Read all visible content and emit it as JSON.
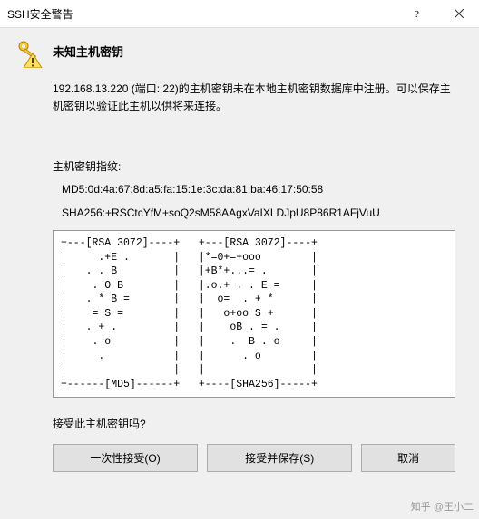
{
  "window": {
    "title": "SSH安全警告"
  },
  "header": {
    "title": "未知主机密钥"
  },
  "message": "192.168.13.220 (端口: 22)的主机密钥未在本地主机密钥数据库中注册。可以保存主机密钥以验证此主机以供将来连接。",
  "fingerprint": {
    "label": "主机密钥指纹:",
    "md5": "MD5:0d:4a:67:8d:a5:fa:15:1e:3c:da:81:ba:46:17:50:58",
    "sha256": "SHA256:+RSCtcYfM+soQ2sM58AAgxVaIXLDJpU8P86R1AFjVuU",
    "ascii": "+---[RSA 3072]----+   +---[RSA 3072]----+\n|     .+E .       |   |*=0+=+ooo        |\n|   . . B         |   |+B*+...= .       |\n|    . O B        |   |.o.+ . . E =     |\n|   . * B =       |   |  o=  . + *      |\n|    = S =        |   |   o+oo S +      |\n|   . + .         |   |    oB . = .     |\n|    . o          |   |    .  B . o     |\n|     .           |   |      . o        |\n|                 |   |                 |\n+------[MD5]------+   +----[SHA256]-----+"
  },
  "prompt": "接受此主机密钥吗?",
  "buttons": {
    "accept_once": "一次性接受(O)",
    "accept_save": "接受并保存(S)",
    "cancel": "取消"
  },
  "watermark": "知乎 @王小二"
}
